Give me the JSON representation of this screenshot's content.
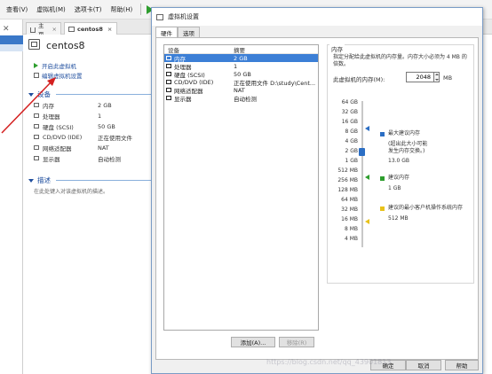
{
  "menubar": {
    "items": [
      "查看(V)",
      "虚拟机(M)",
      "选项卡(T)",
      "帮助(H)"
    ]
  },
  "tabs": [
    {
      "label": "主页"
    },
    {
      "label": "centos8"
    }
  ],
  "vm": {
    "name": "centos8",
    "actions": [
      "开启此虚拟机",
      "编辑虚拟机设置"
    ],
    "devices_title": "设备",
    "devices": [
      {
        "name": "内存",
        "value": "2 GB"
      },
      {
        "name": "处理器",
        "value": "1"
      },
      {
        "name": "硬盘 (SCSI)",
        "value": "50 GB"
      },
      {
        "name": "CD/DVD (IDE)",
        "value": "正在使用文件"
      },
      {
        "name": "网络适配器",
        "value": "NAT"
      },
      {
        "name": "显示器",
        "value": "自动检测"
      }
    ],
    "desc_title": "描述",
    "desc_placeholder": "在此处键入对该虚拟机的描述。"
  },
  "dialog": {
    "title": "虚拟机设置",
    "tabs": [
      "硬件",
      "选项"
    ],
    "list_headers": [
      "设备",
      "摘要"
    ],
    "devices": [
      {
        "name": "内存",
        "summary": "2 GB",
        "icon": "memory-icon"
      },
      {
        "name": "处理器",
        "summary": "1",
        "icon": "cpu-icon"
      },
      {
        "name": "硬盘 (SCSI)",
        "summary": "50 GB",
        "icon": "disk-icon"
      },
      {
        "name": "CD/DVD (IDE)",
        "summary": "正在使用文件 D:\\study\\Cent...",
        "icon": "cdrom-icon"
      },
      {
        "name": "网络适配器",
        "summary": "NAT",
        "icon": "network-icon"
      },
      {
        "name": "显示器",
        "summary": "自动检测",
        "icon": "display-icon"
      }
    ],
    "add_button": "添加(A)...",
    "remove_button": "移除(R)",
    "memory": {
      "group_title": "内存",
      "description": "指定分配给此虚拟机的内存量。内存大小必须为 4 MB 的倍数。",
      "label": "此虚拟机的内存(M):",
      "value": "2048",
      "unit": "MB",
      "scale": [
        "64 GB",
        "32 GB",
        "16 GB",
        "8 GB",
        "4 GB",
        "2 GB",
        "1 GB",
        "512 MB",
        "256 MB",
        "128 MB",
        "64 MB",
        "32 MB",
        "16 MB",
        "8 MB",
        "4 MB"
      ],
      "legend": {
        "max_recommended": {
          "title": "最大建议内存",
          "note_line1": "(超出此大小可能",
          "note_line2": "发生内存交换。)",
          "value": "13.0 GB"
        },
        "recommended": {
          "title": "建议内存",
          "value": "1 GB"
        },
        "guest_min": {
          "title": "建议的最小客户机操作系统内存",
          "value": "512 MB"
        }
      },
      "colors": {
        "max": "#2b6ec4",
        "recommended": "#2e9e2e",
        "guest_min": "#e8c21a"
      }
    },
    "ok_button": "确定",
    "cancel_button": "取消",
    "help_button": "帮助"
  },
  "watermark": "https://blog.csdn.net/qq_43901813"
}
